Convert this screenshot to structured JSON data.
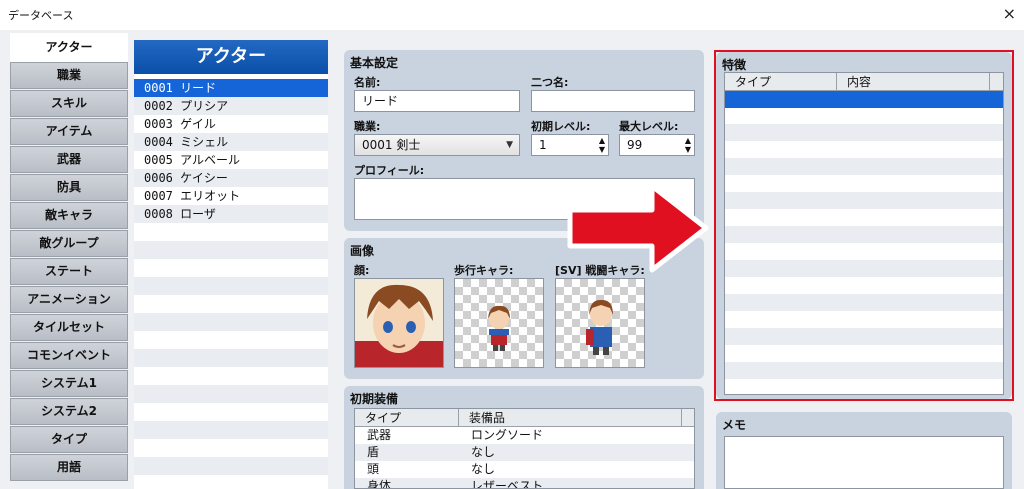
{
  "window": {
    "title": "データベース",
    "close_icon": "×"
  },
  "categories": [
    {
      "label": "アクター",
      "active": true
    },
    {
      "label": "職業"
    },
    {
      "label": "スキル"
    },
    {
      "label": "アイテム"
    },
    {
      "label": "武器"
    },
    {
      "label": "防具"
    },
    {
      "label": "敵キャラ"
    },
    {
      "label": "敵グループ"
    },
    {
      "label": "ステート"
    },
    {
      "label": "アニメーション"
    },
    {
      "label": "タイルセット"
    },
    {
      "label": "コモンイベント"
    },
    {
      "label": "システム1"
    },
    {
      "label": "システム2"
    },
    {
      "label": "タイプ"
    },
    {
      "label": "用語"
    }
  ],
  "actor_list": {
    "header": "アクター",
    "items": [
      "0001 リード",
      "0002 プリシア",
      "0003 ゲイル",
      "0004 ミシェル",
      "0005 アルベール",
      "0006 ケイシー",
      "0007 エリオット",
      "0008 ローザ"
    ],
    "selected_index": 0
  },
  "basic": {
    "title": "基本設定",
    "name_label": "名前:",
    "name_value": "リード",
    "nickname_label": "二つ名:",
    "nickname_value": "",
    "class_label": "職業:",
    "class_value": "0001 剣士",
    "initial_level_label": "初期レベル:",
    "initial_level_value": "1",
    "max_level_label": "最大レベル:",
    "max_level_value": "99",
    "profile_label": "プロフィール:",
    "profile_value": ""
  },
  "images": {
    "title": "画像",
    "face_label": "顔:",
    "walk_label": "歩行キャラ:",
    "battler_label": "[SV] 戦闘キャラ:"
  },
  "equipment": {
    "title": "初期装備",
    "col_type": "タイプ",
    "col_item": "装備品",
    "rows": [
      {
        "type": "武器",
        "item": "ロングソード"
      },
      {
        "type": "盾",
        "item": "なし"
      },
      {
        "type": "頭",
        "item": "なし"
      },
      {
        "type": "身体",
        "item": "レザーベスト"
      }
    ]
  },
  "traits": {
    "title": "特徴",
    "col_type": "タイプ",
    "col_content": "内容"
  },
  "memo": {
    "title": "メモ",
    "value": ""
  },
  "colors": {
    "accent": "#0a4fa8",
    "selection": "#1565d8",
    "highlight": "#e01020",
    "arrow": "#e01020"
  }
}
